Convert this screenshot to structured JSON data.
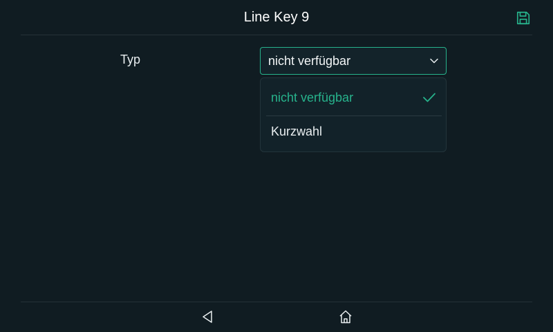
{
  "header": {
    "title": "Line Key 9",
    "save_icon": "save-icon"
  },
  "form": {
    "type_label": "Typ",
    "type_select": {
      "value": "nicht verfügbar",
      "options": [
        {
          "label": "nicht verfügbar",
          "selected": true
        },
        {
          "label": "Kurzwahl",
          "selected": false
        }
      ]
    }
  },
  "nav": {
    "back_icon": "back-triangle-icon",
    "home_icon": "home-icon"
  },
  "colors": {
    "background": "#101c22",
    "accent": "#27b38c",
    "text": "#e9eef0"
  }
}
